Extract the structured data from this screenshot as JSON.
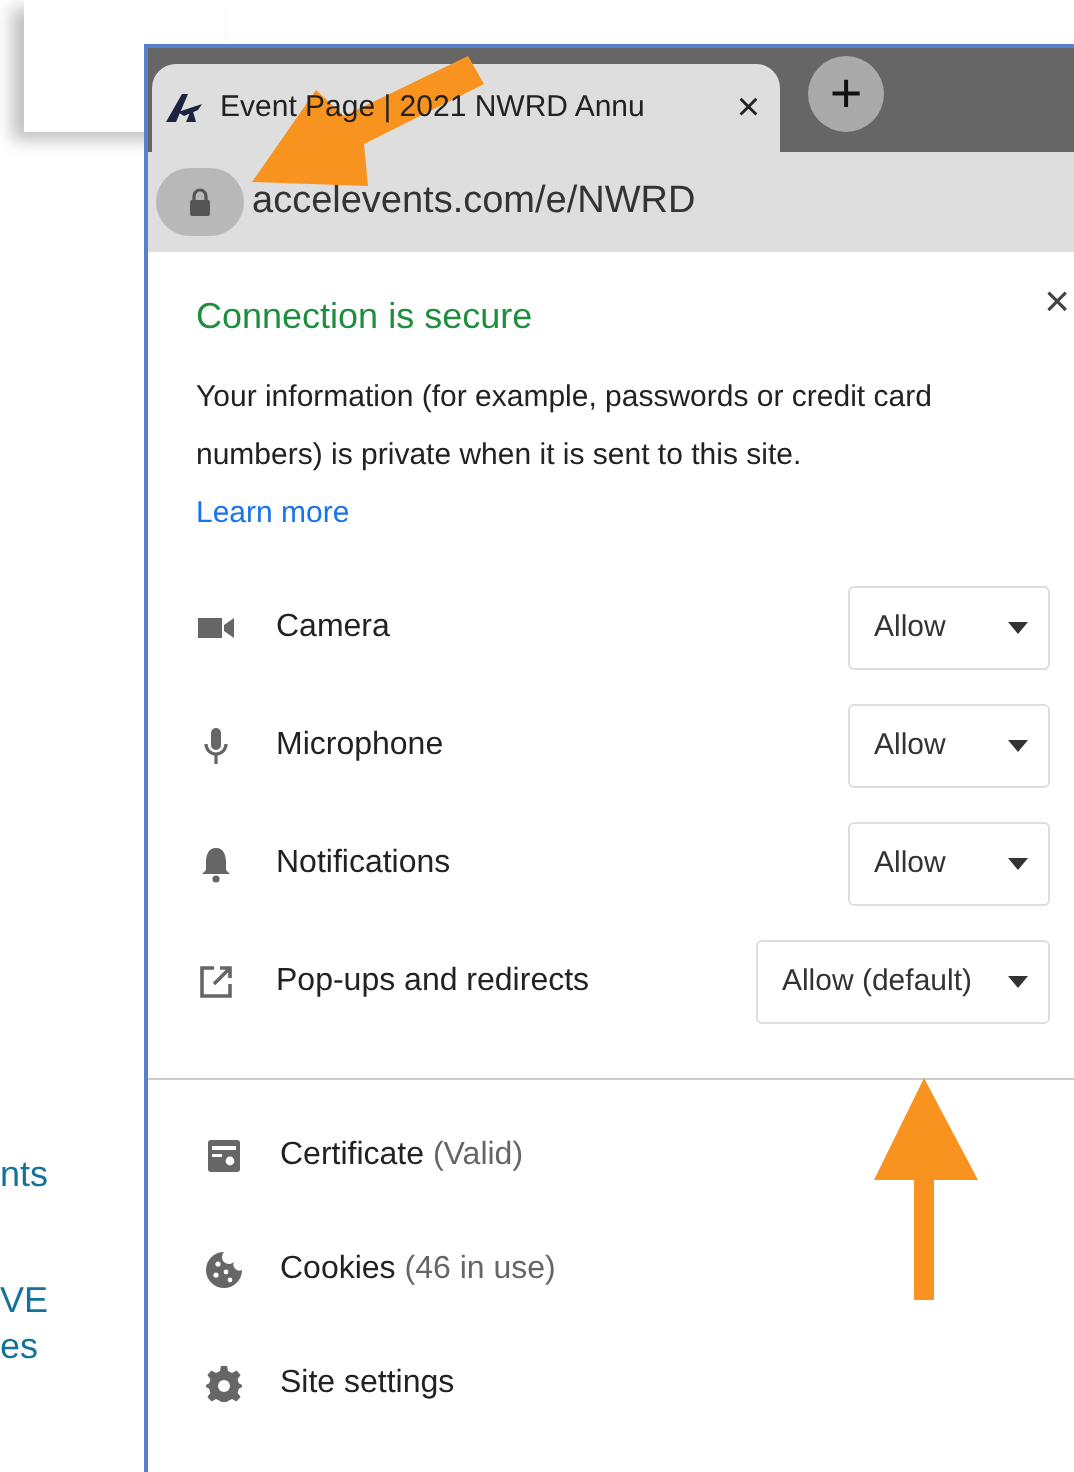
{
  "background_texts": [
    "nts",
    "VE",
    "es"
  ],
  "tab": {
    "title": "Event Page | 2021 NWRD Annu",
    "close": "×"
  },
  "new_tab": "+",
  "address_bar": {
    "url": "accelevents.com/e/NWRD"
  },
  "popup": {
    "close": "×",
    "title": "Connection is secure",
    "description": "Your information (for example, passwords or credit card numbers) is private when it is sent to this site.",
    "link": "Learn more",
    "permissions": [
      {
        "kind": "camera",
        "label": "Camera",
        "value": "Allow"
      },
      {
        "kind": "microphone",
        "label": "Microphone",
        "value": "Allow"
      },
      {
        "kind": "notifications",
        "label": "Notifications",
        "value": "Allow"
      },
      {
        "kind": "popups",
        "label": "Pop-ups and redirects",
        "value": "Allow (default)"
      }
    ],
    "items": [
      {
        "kind": "certificate",
        "label": "Certificate",
        "detail": "(Valid)"
      },
      {
        "kind": "cookies",
        "label": "Cookies",
        "detail": "(46 in use)"
      },
      {
        "kind": "settings",
        "label": "Site settings"
      }
    ]
  }
}
